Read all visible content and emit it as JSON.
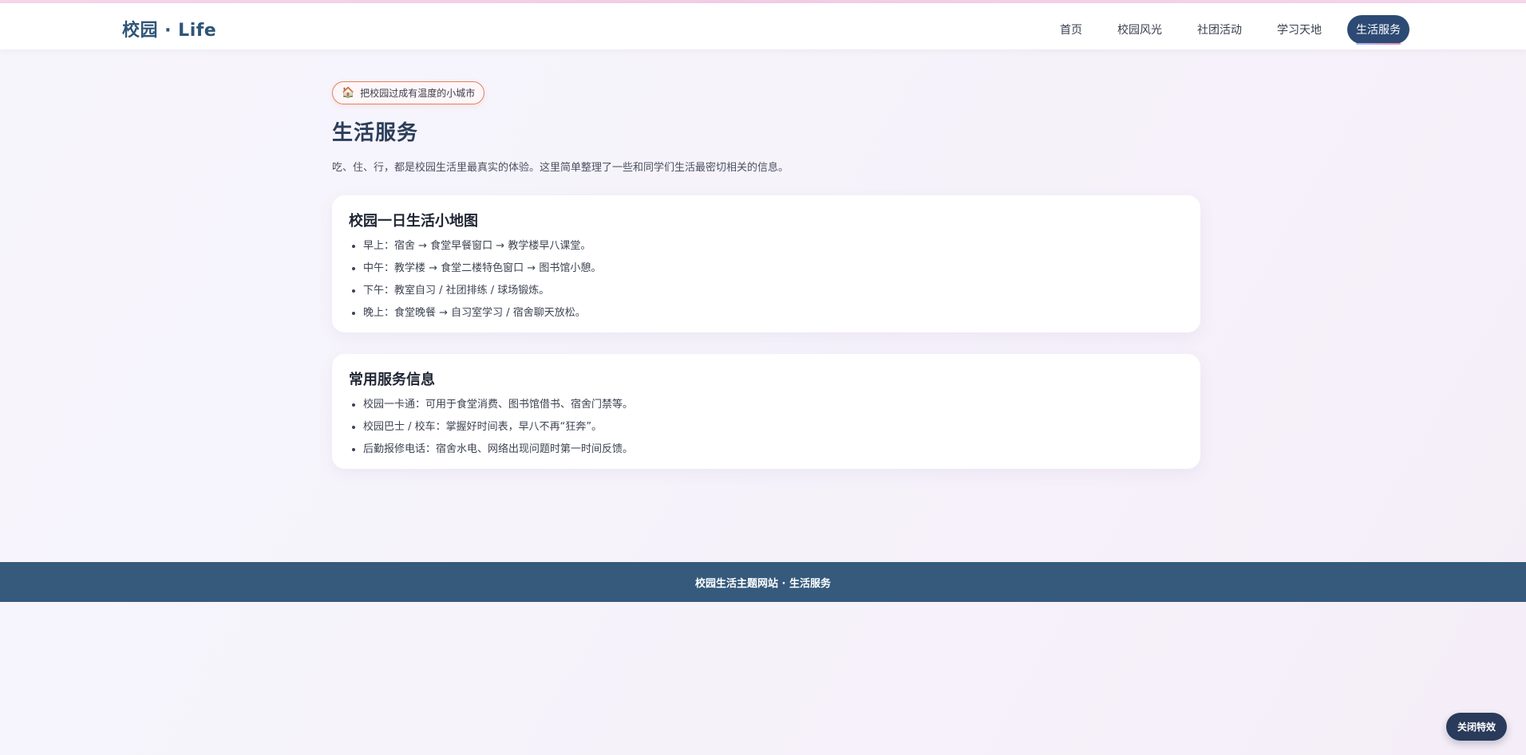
{
  "header": {
    "logo": "校园 · Life",
    "nav": [
      {
        "label": "首页"
      },
      {
        "label": "校园风光"
      },
      {
        "label": "社团活动"
      },
      {
        "label": "学习天地"
      },
      {
        "label": "生活服务",
        "active": true
      }
    ]
  },
  "main": {
    "badge": {
      "icon": "🏠",
      "text": "把校园过成有温度的小城市"
    },
    "title": "生活服务",
    "intro": "吃、住、行，都是校园生活里最真实的体验。这里简单整理了一些和同学们生活最密切相关的信息。",
    "cards": [
      {
        "title": "校园一日生活小地图",
        "items": [
          "早上：宿舍 → 食堂早餐窗口 → 教学楼早八课堂。",
          "中午：教学楼 → 食堂二楼特色窗口 → 图书馆小憩。",
          "下午：教室自习 / 社团排练 / 球场锻炼。",
          "晚上：食堂晚餐 → 自习室学习 / 宿舍聊天放松。"
        ]
      },
      {
        "title": "常用服务信息",
        "items": [
          "校园一卡通：可用于食堂消费、图书馆借书、宿舍门禁等。",
          "校园巴士 / 校车：掌握好时间表，早八不再“狂奔”。",
          "后勤报修电话：宿舍水电、网络出现问题时第一时间反馈。"
        ]
      }
    ]
  },
  "footer": {
    "text": "校园生活主题网站 · 生活服务"
  },
  "fx_button": {
    "label": "关闭特效"
  },
  "colors": {
    "brand": "#2f5577",
    "nav_active_bg": "#2c4a73",
    "footer_bg": "#355a7c",
    "badge_border": "#e97f63"
  }
}
